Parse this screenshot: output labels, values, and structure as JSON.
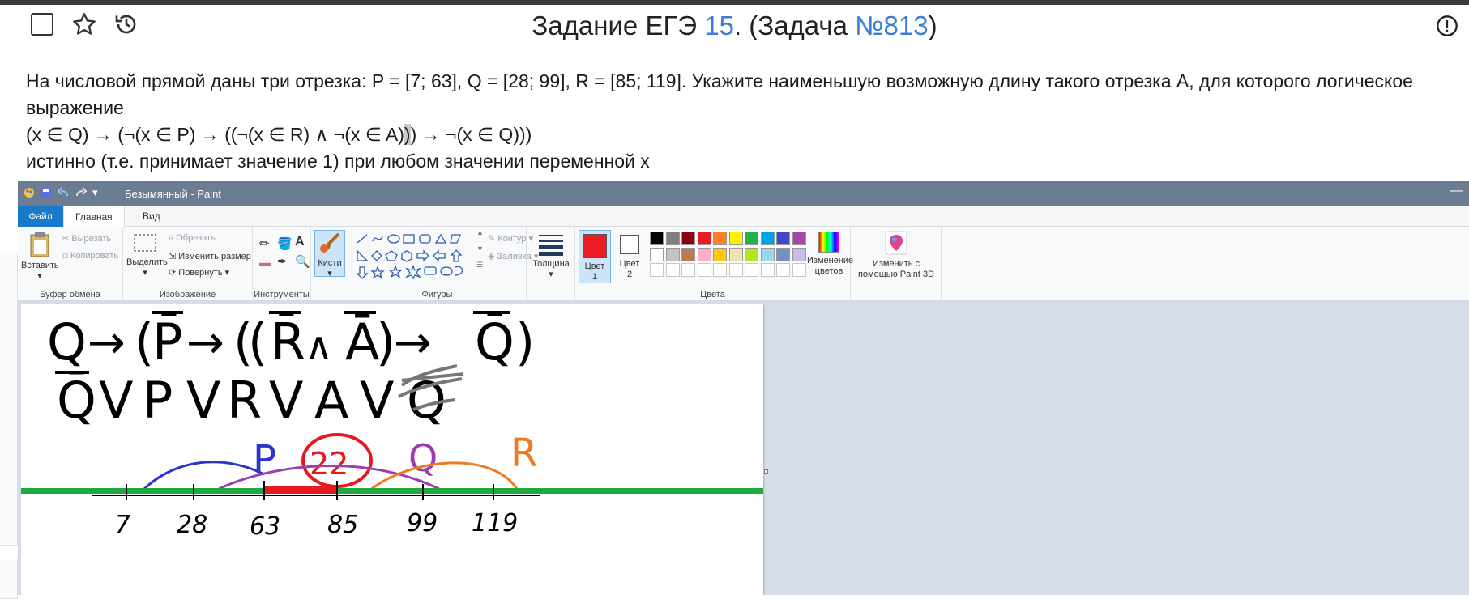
{
  "header": {
    "title_prefix": "Задание ЕГЭ ",
    "task_number": "15",
    "title_mid": ". (Задача ",
    "problem_id": "№813",
    "title_suffix": ")",
    "icons": [
      "checkbox-icon",
      "star-icon",
      "history-icon",
      "alert-icon"
    ]
  },
  "problem": {
    "line1": "На числовой прямой даны три отрезка: P = [7; 63], Q = [28; 99], R = [85; 119]. Укажите наименьшую возможную длину такого отрезка A, для которого логическое выражение",
    "formula_a": "(x ∈ Q) → (¬(x ∈ P) → ((¬(x ∈ R) ∧ ¬(x ∈ A)",
    "formula_hl": ")",
    "formula_b": ") → ¬(x ∈ Q)))",
    "line3": "истинно (т.е. принимает значение 1) при любом значении переменной x"
  },
  "paint": {
    "window_title": "Безымянный - Paint",
    "tabs": [
      "Файл",
      "Главная",
      "Вид"
    ],
    "clipboard": {
      "paste": "Вставить",
      "cut": "Вырезать",
      "copy": "Копировать",
      "label": "Буфер обмена"
    },
    "image": {
      "select": "Выделить",
      "crop": "Обрезать",
      "resize": "Изменить размер",
      "rotate": "Повернуть",
      "label": "Изображение"
    },
    "tools": {
      "label": "Инструменты",
      "brushes": "Кисти"
    },
    "shapes": {
      "outline": "Контур",
      "fill": "Заливка",
      "label": "Фигуры"
    },
    "thickness": "Толщина",
    "color1": "Цвет 1",
    "color2": "Цвет 2",
    "colors_label": "Цвета",
    "edit_colors": "Изменение цветов",
    "paint3d": "Изменить с помощью Paint 3D",
    "palette_row1": [
      "#000000",
      "#7f7f7f",
      "#880015",
      "#ed1c24",
      "#ff7f27",
      "#fff200",
      "#22b14c",
      "#00a2e8",
      "#3f48cc",
      "#a349a4"
    ],
    "palette_row2": [
      "#ffffff",
      "#c3c3c3",
      "#b97a57",
      "#ffaec9",
      "#ffc90e",
      "#efe4b0",
      "#b5e61d",
      "#99d9ea",
      "#7092be",
      "#c8bfe7"
    ]
  },
  "drawing": {
    "line1": [
      "Q",
      "→",
      "(",
      "P̄",
      "→",
      "(",
      "(",
      "R̄",
      "∧",
      "Ā",
      ")",
      "→",
      "Q̄",
      ")"
    ],
    "line2": [
      "Q̄",
      "V",
      "P",
      "V",
      "R",
      "V",
      "A",
      "V",
      "Q"
    ],
    "labels": {
      "P": "P",
      "Q": "Q",
      "R": "R",
      "answer": "22"
    },
    "ticks": [
      "7",
      "28",
      "63",
      "85",
      "99",
      "119"
    ]
  }
}
